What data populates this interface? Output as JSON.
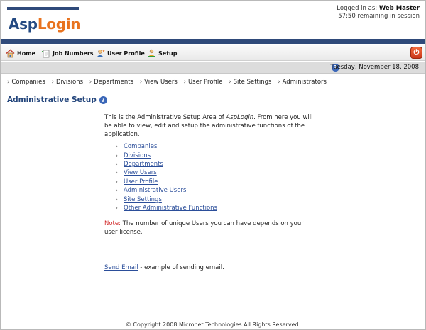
{
  "header": {
    "logo_asp": "Asp",
    "logo_login": "Login",
    "logged_in_label": "Logged in as:",
    "user_name": "Web Master",
    "session_time": "57:50",
    "session_suffix": "remaining in session"
  },
  "toolbar": {
    "items": [
      {
        "label": "Home",
        "icon": "house-icon"
      },
      {
        "label": "Job Numbers",
        "icon": "plus-document-icon"
      },
      {
        "label": "User Profile",
        "icon": "user-icon"
      },
      {
        "label": "Setup",
        "icon": "person-setup-icon"
      }
    ],
    "power_icon": "power-icon"
  },
  "date_bar": {
    "date": "Tuesday, November 18, 2008"
  },
  "subnav": {
    "items": [
      "Companies",
      "Divisions",
      "Departments",
      "View Users",
      "User Profile",
      "Site Settings",
      "Administrators"
    ]
  },
  "page": {
    "title": "Administrative Setup",
    "intro_prefix": "This is the Administrative Setup Area of ",
    "intro_app": "AspLogin",
    "intro_suffix": ". From here you will be able to view, edit and setup the administrative functions of the application.",
    "links": [
      "Companies",
      "Divisions",
      "Departments",
      "View Users",
      "User Profile",
      "Administrative Users",
      "Site Settings",
      "Other Administrative Functions"
    ],
    "note_label": "Note:",
    "note_text": " The number of unique Users you can have depends on your user license.",
    "email_link": "Send Email",
    "email_suffix": " - example of sending email."
  },
  "footer": {
    "text": "© Copyright 2008 Micronet Technologies All Rights Reserved."
  },
  "colors": {
    "brand_blue": "#2f4a7a",
    "brand_orange": "#e8731f",
    "link": "#2b4e9a",
    "note_red": "#d12a2a"
  }
}
